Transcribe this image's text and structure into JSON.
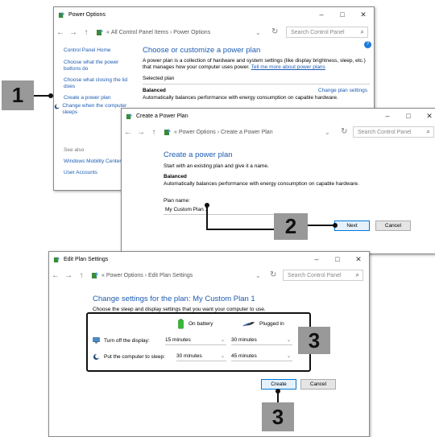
{
  "win1": {
    "title": "Power Options",
    "minimize": "–",
    "maximize": "□",
    "close": "✕",
    "breadcrumb": [
      "All Control Panel Items",
      "Power Options"
    ],
    "search_placeholder": "Search Control Panel",
    "sidebar": {
      "home": "Control Panel Home",
      "items": [
        "Choose what the power buttons do",
        "Choose what closing the lid does",
        "Create a power plan",
        "Change when the computer sleeps"
      ],
      "see_also": "See also",
      "see_also_items": [
        "Windows Mobility Center",
        "User Accounts"
      ]
    },
    "heading": "Choose or customize a power plan",
    "description": "A power plan is a collection of hardware and system settings (like display brightness, sleep, etc.) that manages how your computer uses power.",
    "tell_me_more": "Tell me more about power plans",
    "selected_plan": "Selected plan",
    "plan_name": "Balanced",
    "change_settings": "Change plan settings",
    "plan_desc": "Automatically balances performance with energy consumption on capable hardware."
  },
  "win2": {
    "title": "Create a Power Plan",
    "minimize": "–",
    "maximize": "□",
    "close": "✕",
    "breadcrumb": [
      "Power Options",
      "Create a Power Plan"
    ],
    "search_placeholder": "Search Control Panel",
    "heading": "Create a power plan",
    "subtext": "Start with an existing plan and give it a name.",
    "plan_name": "Balanced",
    "plan_desc": "Automatically balances performance with energy consumption on capable hardware.",
    "field_label": "Plan name:",
    "field_value": "My Custom Plan 1",
    "next": "Next",
    "cancel": "Cancel"
  },
  "win3": {
    "title": "Edit Plan Settings",
    "minimize": "–",
    "maximize": "□",
    "close": "✕",
    "breadcrumb": [
      "Power Options",
      "Edit Plan Settings"
    ],
    "search_placeholder": "Search Control Panel",
    "heading": "Change settings for the plan: My Custom Plan 1",
    "subtext": "Choose the sleep and display settings that you want your computer to use.",
    "on_battery": "On battery",
    "plugged_in": "Plugged in",
    "rows": [
      {
        "label": "Turn off the display:",
        "battery": "15 minutes",
        "plugged": "30 minutes"
      },
      {
        "label": "Put the computer to sleep:",
        "battery": "30 minutes",
        "plugged": "45 minutes"
      }
    ],
    "create": "Create",
    "cancel": "Cancel"
  },
  "callouts": {
    "one": "1",
    "two": "2",
    "three_a": "3",
    "three_b": "3"
  },
  "colors": {
    "accent": "#1e5cb3",
    "callout": "#999999",
    "highlight": "#111111"
  }
}
